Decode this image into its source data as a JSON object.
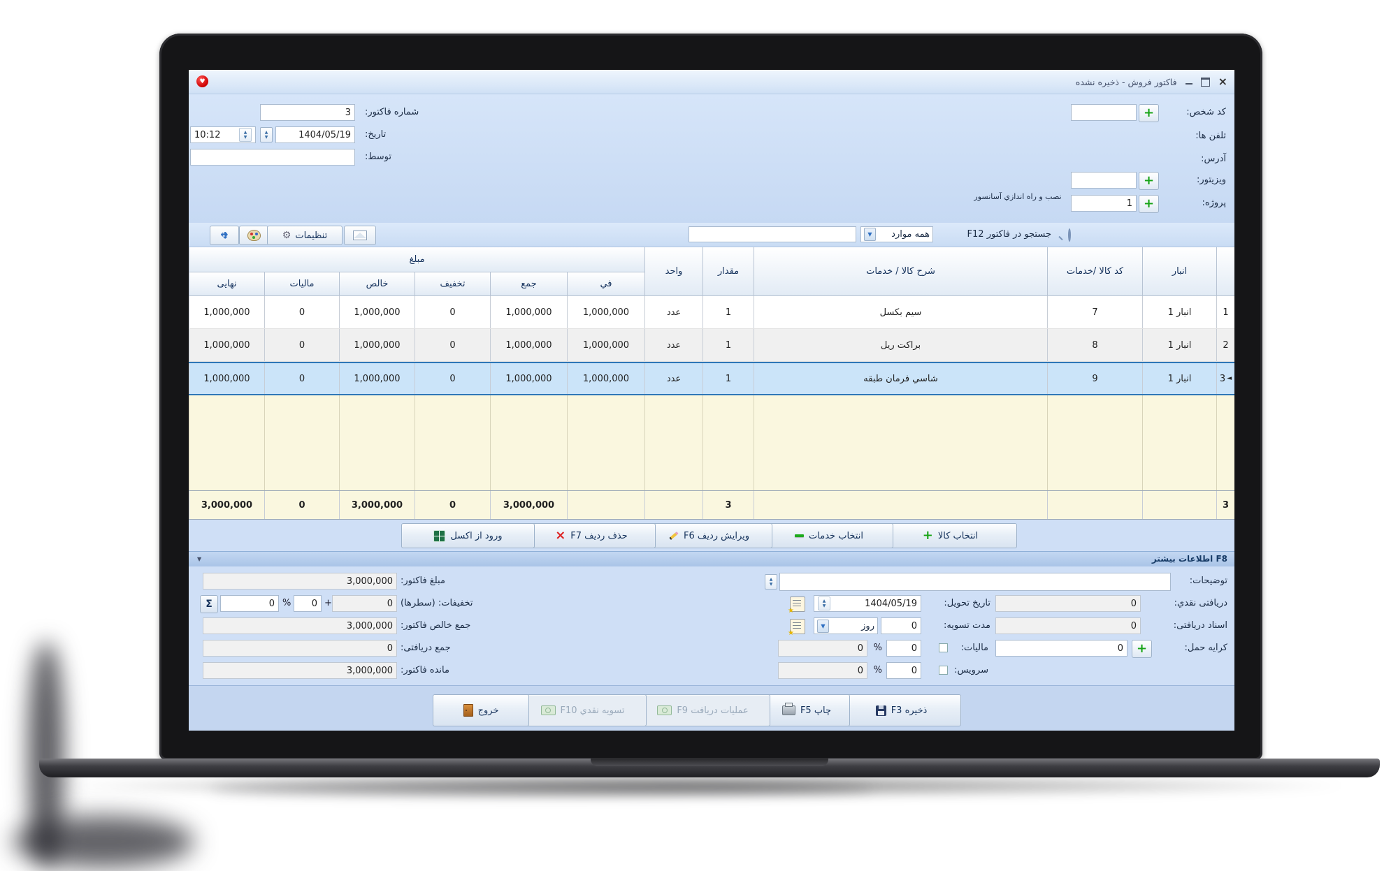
{
  "window": {
    "title": "فاکتور فروش - ذخیره نشده"
  },
  "icons": {
    "app_logo": "♥",
    "close": "×",
    "gear": "⚙",
    "dropdown": "▼",
    "f8_arrow": "▼",
    "selected_marker": "◄",
    "plus": "+",
    "delete_x": "×",
    "sigma": "Σ"
  },
  "header": {
    "person_code_label": "کد شخص:",
    "phones_label": "تلفن ها:",
    "address_label": "آدرس:",
    "visitor_label": "ویزیتور:",
    "project_label": "پروژه:",
    "project_value": "1",
    "project_note": "نصب و راه اندازي آسانسور",
    "invoice_no_label": "شماره فاکتور:",
    "invoice_no": "3",
    "date_label": "تاریخ:",
    "date": "1404/05/19",
    "time": "10:12",
    "by_label": "توسط:"
  },
  "toolbar": {
    "settings_label": "تنظیمات",
    "search_label": "جستجو در فاکتور F12",
    "search_filter": "همه موارد"
  },
  "grid": {
    "amount_group_label": "مبلغ",
    "columns": {
      "final": "نهایی",
      "tax": "مالیات",
      "net": "خالص",
      "discount": "تخفیف",
      "sum": "جمع",
      "price": "في",
      "unit": "واحد",
      "qty": "مقدار",
      "desc": "شرح کالا / خدمات",
      "code": "کد کالا /خدمات",
      "store": "انبار"
    },
    "rows": [
      {
        "no": "1",
        "final": "1,000,000",
        "tax": "0",
        "net": "1,000,000",
        "discount": "0",
        "sum": "1,000,000",
        "price": "1,000,000",
        "unit": "عدد",
        "qty": "1",
        "desc": "سیم بکسل",
        "code": "7",
        "store": "انبار 1"
      },
      {
        "no": "2",
        "final": "1,000,000",
        "tax": "0",
        "net": "1,000,000",
        "discount": "0",
        "sum": "1,000,000",
        "price": "1,000,000",
        "unit": "عدد",
        "qty": "1",
        "desc": "براکت ریل",
        "code": "8",
        "store": "انبار 1"
      },
      {
        "no": "3",
        "final": "1,000,000",
        "tax": "0",
        "net": "1,000,000",
        "discount": "0",
        "sum": "1,000,000",
        "price": "1,000,000",
        "unit": "عدد",
        "qty": "1",
        "desc": "شاسي فرمان طبقه",
        "code": "9",
        "store": "انبار 1"
      }
    ],
    "totals": {
      "no": "3",
      "final": "3,000,000",
      "tax": "0",
      "net": "3,000,000",
      "discount": "0",
      "sum": "3,000,000",
      "qty": "3"
    }
  },
  "grid_actions": {
    "excel_import": "ورود از اکسل",
    "delete_row": "حذف ردیف F7",
    "edit_row": "ویرایش ردیف F6",
    "select_services": "انتخاب خدمات",
    "select_goods": "انتخاب کالا"
  },
  "more_info_bar": {
    "label": "F8 اطلاعات بیشتر"
  },
  "summary": {
    "invoice_amount_label": "مبلغ فاکتور:",
    "invoice_amount": "3,000,000",
    "discounts_label": "تخفیفات: (سطرها)",
    "discount_rows": "0",
    "discount_plus": "+",
    "discount_amount": "0",
    "percent_sign": "%",
    "discount_percent": "0",
    "net_total_label": "جمع خالص فاکتور:",
    "net_total": "3,000,000",
    "received_total_label": "جمع دریافتی:",
    "received_total": "0",
    "balance_label": "مانده فاکتور:",
    "balance": "3,000,000"
  },
  "details": {
    "notes_label": "توضیحات:",
    "cash_received_label": "دریافتی نقدي:",
    "cash_received": "0",
    "delivery_date_label": "تاریخ تحویل:",
    "delivery_date": "1404/05/19",
    "received_docs_label": "اسناد دریافتی:",
    "received_docs": "0",
    "settle_period_label": "مدت تسویه:",
    "settle_period": "0",
    "settle_unit": "روز",
    "freight_label": "کرایه حمل:",
    "freight": "0",
    "tax_label": "مالیات:",
    "tax_percent": "0",
    "tax_amount": "0",
    "service_label": "سرویس:",
    "service_percent": "0",
    "service_amount": "0",
    "percent_sign": "%"
  },
  "footer": {
    "save": "ذخیره F3",
    "print": "چاپ F5",
    "receive_ops": "عملیات دریافت F9",
    "cash_settle": "تسویه نقدي F10",
    "exit": "خروج"
  },
  "colors": {
    "window_blue": "#cfe0f6",
    "selected_row": "#cbe4f9",
    "empty_rows_cream": "#faf7df",
    "accent_green": "#1daa1d",
    "header_text": "#15325d",
    "selection_border": "#2e77b8"
  }
}
